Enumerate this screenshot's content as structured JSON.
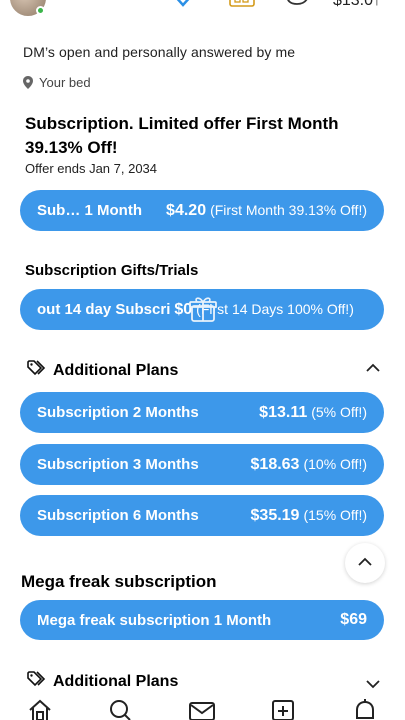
{
  "header": {
    "balance": "$13.0↑"
  },
  "profile": {
    "bio": "DM’s open and personally answered by me",
    "location": "Your bed"
  },
  "offer": {
    "title": "Subscription. Limited offer First Month 39.13% Off!",
    "ends": "Offer ends Jan 7, 2034",
    "button": {
      "label": "Sub… 1 Month",
      "price": "$4.20",
      "discount": "(First Month 39.13% Off!)"
    }
  },
  "gifts": {
    "title": "Subscription Gifts/Trials",
    "button": {
      "label": "out 14 day Subscri",
      "price": "$0",
      "discount": "(First 14 Days 100% Off!)"
    }
  },
  "additional_plans": {
    "title": "Additional Plans",
    "plans": [
      {
        "label": "Subscription 2 Months",
        "price": "$13.11",
        "discount": "(5% Off!)"
      },
      {
        "label": "Subscription 3 Months",
        "price": "$18.63",
        "discount": "(10% Off!)"
      },
      {
        "label": "Subscription 6 Months",
        "price": "$35.19",
        "discount": "(15% Off!)"
      }
    ]
  },
  "mega": {
    "title": "Mega freak subscription",
    "button": {
      "label": "Mega freak subscription 1 Month",
      "price": "$69"
    }
  },
  "additional_plans_2": {
    "title": "Additional Plans"
  },
  "nav": [
    "home-icon",
    "search-icon",
    "messages-icon",
    "add-post-icon",
    "notifications-icon"
  ],
  "colors": {
    "accent": "#3d98ea",
    "online": "#3bb54a"
  }
}
